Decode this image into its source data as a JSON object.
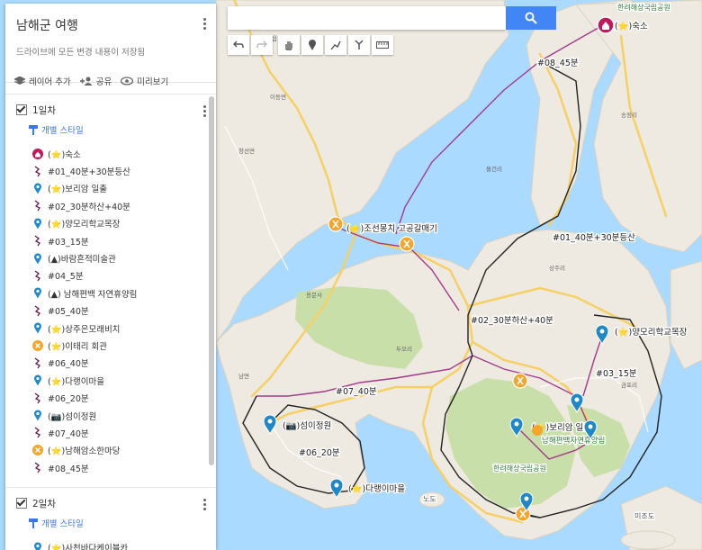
{
  "panel": {
    "title": "남해군 여행",
    "subtitle": "드라이브에 모든 변경 내용이 저장됨",
    "toolbar": {
      "add_layer": "레이어 추가",
      "share": "공유",
      "preview": "미리보기"
    }
  },
  "layers": [
    {
      "name": "1일차",
      "style_link": "개별 스타일",
      "items": [
        {
          "icon": "home-marker-icon",
          "label": "(⭐)숙소"
        },
        {
          "icon": "route-icon",
          "label": "#01_40분+30분등산"
        },
        {
          "icon": "marker-blue-icon",
          "label": "(⭐)보리암 일출"
        },
        {
          "icon": "route-icon",
          "label": "#02_30분하산+40분"
        },
        {
          "icon": "marker-blue-icon",
          "label": "(⭐)양모리학교목장"
        },
        {
          "icon": "route-icon",
          "label": "#03_15분"
        },
        {
          "icon": "marker-blue-icon",
          "label": "(▲)바람흔적미술관"
        },
        {
          "icon": "route-icon",
          "label": "#04_5분"
        },
        {
          "icon": "marker-blue-icon",
          "label": "(▲) 남해편백 자연휴양림"
        },
        {
          "icon": "route-icon",
          "label": "#05_40분"
        },
        {
          "icon": "marker-blue-icon",
          "label": "(⭐)상주은모래비치"
        },
        {
          "icon": "restaurant-marker-icon",
          "label": "(⭐)이태리 회관"
        },
        {
          "icon": "route-icon",
          "label": "#06_40분"
        },
        {
          "icon": "marker-blue-icon",
          "label": "(⭐)다랭이마을"
        },
        {
          "icon": "route-icon",
          "label": "#06_20분"
        },
        {
          "icon": "marker-blue-icon",
          "label": "(📷)섬이정원"
        },
        {
          "icon": "route-icon",
          "label": "#07_40분"
        },
        {
          "icon": "restaurant-marker-icon",
          "label": "(⭐)남해암소한마당"
        },
        {
          "icon": "route-icon",
          "label": "#08_45분"
        }
      ]
    },
    {
      "name": "2일차",
      "style_link": "개별 스타일",
      "items": [
        {
          "icon": "marker-blue-icon",
          "label": "(⭐)사천바다케이블카"
        }
      ]
    }
  ],
  "map": {
    "search_placeholder": "",
    "labels": {
      "lodging": "(⭐)숙소",
      "r08": "#08_45분",
      "r01": "#01_40분+30분등산",
      "restaurant1": "(⭐)조선몽치 고공갈매기",
      "r02": "#02_30분하산+40분",
      "ranch": "(⭐)양모리학교목장",
      "r03": "#03_15분",
      "r07": "#07_40분",
      "boriam": "(⭐)보리암 일출",
      "forest": "남해편백자연휴양림",
      "seomi": "(📷)섬이정원",
      "r06": "#06_20분",
      "darangi": "(⭐)다랭이마을",
      "park": "한려해상국립공원",
      "park2": "한려해상국립공원",
      "nodo": "노도",
      "mijo": "미조도"
    }
  },
  "colors": {
    "accent": "#4285f4",
    "route_pink": "#c0397e",
    "route_black": "#222222",
    "marker_blue": "#1e88c9",
    "restaurant": "#f4a52a",
    "home": "#c2185b"
  }
}
